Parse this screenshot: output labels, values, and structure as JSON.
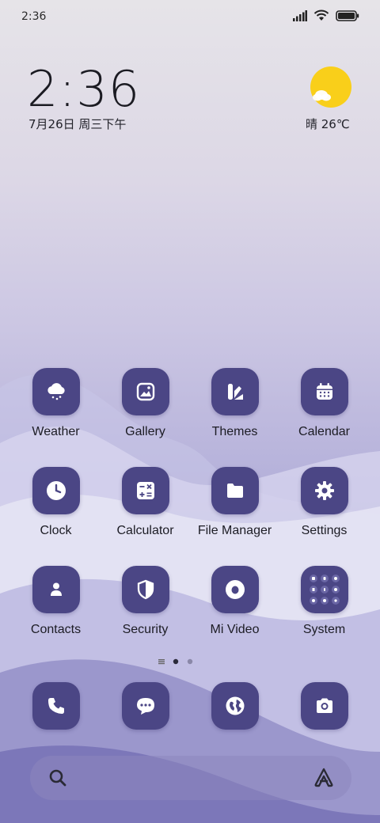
{
  "status_bar": {
    "time": "2:36",
    "icons": [
      "signal-icon",
      "wifi-icon",
      "battery-icon"
    ]
  },
  "clock_widget": {
    "time": "2:36",
    "date": "7月26日 周三下午"
  },
  "weather_widget": {
    "text": "晴 26℃",
    "icon": "sunny-partly-cloudy-icon"
  },
  "apps": [
    {
      "label": "Weather",
      "icon": "weather-cloud-icon"
    },
    {
      "label": "Gallery",
      "icon": "gallery-icon"
    },
    {
      "label": "Themes",
      "icon": "themes-icon"
    },
    {
      "label": "Calendar",
      "icon": "calendar-icon"
    },
    {
      "label": "Clock",
      "icon": "clock-icon"
    },
    {
      "label": "Calculator",
      "icon": "calculator-icon"
    },
    {
      "label": "File Manager",
      "icon": "folder-icon"
    },
    {
      "label": "Settings",
      "icon": "gear-icon"
    },
    {
      "label": "Contacts",
      "icon": "contact-icon"
    },
    {
      "label": "Security",
      "icon": "shield-icon"
    },
    {
      "label": "Mi Video",
      "icon": "video-icon"
    },
    {
      "label": "System",
      "icon": "folder-grid-icon"
    }
  ],
  "page_indicator": {
    "pages": 2,
    "current": 1
  },
  "dock": [
    {
      "icon": "phone-icon"
    },
    {
      "icon": "message-icon"
    },
    {
      "icon": "browser-globe-icon"
    },
    {
      "icon": "camera-icon"
    }
  ],
  "search": {
    "icon": "search-icon",
    "assistant_icon": "assistant-icon"
  },
  "colors": {
    "icon_bg": "#4b4685",
    "accent_sun": "#f9cf1a"
  }
}
